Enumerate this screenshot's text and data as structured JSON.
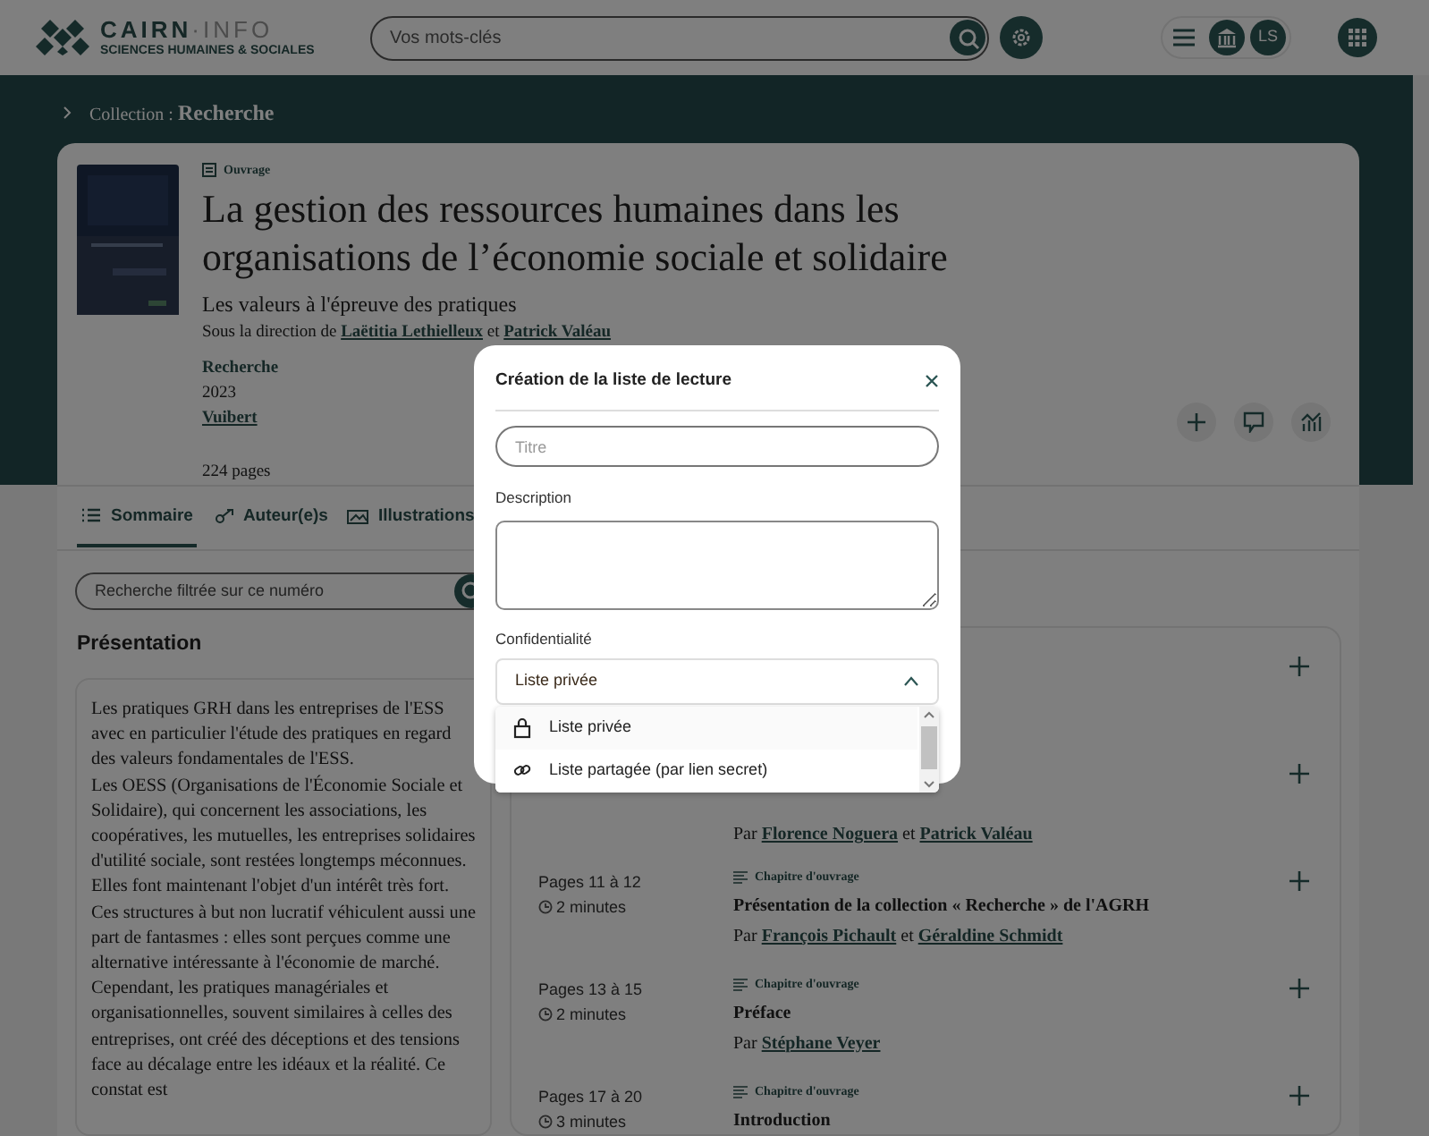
{
  "header": {
    "logo": {
      "name": "CAIRN",
      "name_suffix": "·INFO",
      "tagline": "SCIENCES HUMAINES & SOCIALES"
    },
    "search": {
      "placeholder": "Vos mots-clés"
    },
    "user": {
      "initials": "LS"
    }
  },
  "breadcrumb": {
    "label": "Collection :",
    "value": "Recherche"
  },
  "book": {
    "type": "Ouvrage",
    "title": "La gestion des ressources humaines dans les organisations de l’économie sociale et solidaire",
    "subtitle": "Les valeurs à l'épreuve des pratiques",
    "direction": "Sous la direction de",
    "authors": [
      "Laëtitia Lethielleux",
      "Patrick Valéau"
    ],
    "conjunction": "et",
    "collection": "Recherche",
    "year": "2023",
    "publisher": "Vuibert",
    "pages": "224 pages"
  },
  "tabs": [
    {
      "label": "Sommaire",
      "selected": true
    },
    {
      "label": "Auteur(e)s",
      "selected": false
    },
    {
      "label": "Illustrations",
      "selected": false
    }
  ],
  "filter": {
    "placeholder": "Recherche filtrée sur ce numéro"
  },
  "presentation": {
    "heading": "Présentation",
    "paragraphs": [
      "Les pratiques GRH dans les entreprises de l'ESS avec en particulier l'étude des pratiques en regard des valeurs fondamentales de l'ESS.",
      "Les OESS (Organisations de l'Économie Sociale et Solidaire), qui concernent les associations, les coopératives, les mutuelles, les entreprises solidaires d'utilité sociale, sont restées longtemps méconnues. Elles font maintenant l'objet d'un intérêt très fort.",
      "Ces structures à but non lucratif véhiculent aussi une part de fantasmes : elles sont perçues comme une alternative intéressante à l'économie de marché. Cependant, les pratiques managériales et organisationnelles, souvent similaires à celles des entreprises, ont créé des déceptions et des tensions face au décalage entre les idéaux et la réalité. Ce constat est"
    ]
  },
  "toc": [
    {
      "addable": true
    },
    {
      "addable": true,
      "by": "Par",
      "authors": [
        "Florence Noguera",
        "Patrick Valéau"
      ],
      "conjunction": "et"
    },
    {
      "addable": true,
      "pages": "Pages 11 à 12",
      "duration": "2 minutes",
      "type": "Chapitre d'ouvrage",
      "title": "Présentation de la collection « Recherche » de l'AGRH",
      "by": "Par",
      "authors": [
        "François Pichault",
        "Géraldine Schmidt"
      ],
      "conjunction": "et"
    },
    {
      "addable": true,
      "pages": "Pages 13 à 15",
      "duration": "2 minutes",
      "type": "Chapitre d'ouvrage",
      "title": "Préface",
      "by": "Par",
      "authors": [
        "Stéphane Veyer"
      ]
    },
    {
      "addable": true,
      "pages": "Pages 17 à 20",
      "duration": "3 minutes",
      "type": "Chapitre d'ouvrage",
      "title": "Introduction"
    }
  ],
  "modal": {
    "title": "Création de la liste de lecture",
    "title_field": {
      "placeholder": "Titre"
    },
    "description_label": "Description",
    "privacy_label": "Confidentialité",
    "privacy": {
      "value": "Liste privée",
      "expanded": true
    },
    "options": [
      {
        "label": "Liste privée",
        "kind": "lock",
        "selected": true
      },
      {
        "label": "Liste partagée (par lien secret)",
        "kind": "link",
        "selected": false
      }
    ]
  }
}
